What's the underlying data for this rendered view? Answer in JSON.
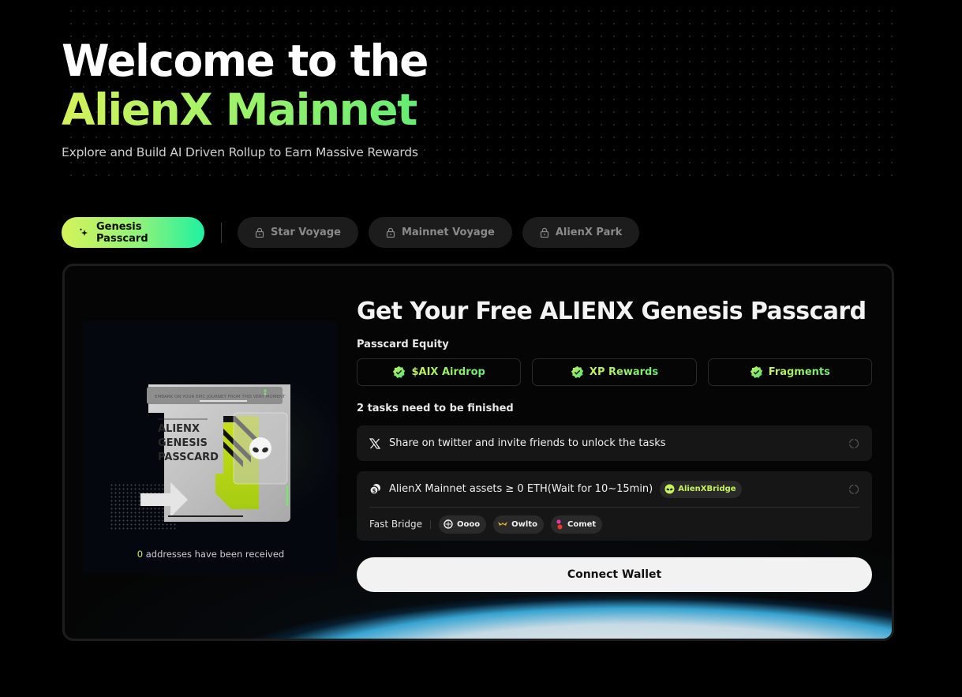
{
  "hero": {
    "title_line1": "Welcome to the",
    "title_line2": "AlienX Mainnet",
    "subtitle": "Explore and Build AI Driven Rollup to Earn Massive Rewards"
  },
  "tabs": [
    {
      "label": "Genesis Passcard",
      "icon": "sparkle-icon",
      "active": true,
      "locked": false
    },
    {
      "label": "Star Voyage",
      "icon": "lock-icon",
      "active": false,
      "locked": true
    },
    {
      "label": "Mainnet Voyage",
      "icon": "lock-icon",
      "active": false,
      "locked": true
    },
    {
      "label": "AlienX Park",
      "icon": "lock-icon",
      "active": false,
      "locked": true
    }
  ],
  "passcard": {
    "art_header": "EMBARK ON YOUR EPIC JOURNEY FROM THIS VERY MOMENT",
    "art_title": [
      "ALIENX",
      "GENESIS",
      "PASSCARD"
    ],
    "count": "0",
    "count_suffix": " addresses have been received"
  },
  "main": {
    "title": "Get Your Free ALIENX Genesis Passcard",
    "equity_label": "Passcard Equity",
    "equity": [
      {
        "label": "$AIX Airdrop",
        "icon": "verified-badge-icon"
      },
      {
        "label": "XP Rewards",
        "icon": "verified-badge-icon"
      },
      {
        "label": "Fragments",
        "icon": "verified-badge-icon"
      }
    ],
    "tasks_label": "2 tasks need to be finished",
    "tasks": [
      {
        "icon": "x-twitter-icon",
        "text": "Share on twitter and invite friends to unlock the tasks",
        "status": "loading"
      },
      {
        "icon": "coins-icon",
        "text": "AlienX Mainnet assets ≥ 0 ETH(Wait for 10~15min)",
        "badge": "AlienXBridge",
        "status": "loading"
      }
    ],
    "fast_bridge": {
      "label": "Fast Bridge",
      "options": [
        {
          "label": "Oooo",
          "icon": "oooo-logo-icon"
        },
        {
          "label": "Owlto",
          "icon": "owlto-logo-icon"
        },
        {
          "label": "Comet",
          "icon": "comet-logo-icon"
        }
      ]
    },
    "connect_label": "Connect Wallet"
  },
  "colors": {
    "accent_lime": "#c6f25a",
    "accent_green": "#66ec73",
    "accent_teal": "#1ef2a0",
    "background": "#000000"
  }
}
